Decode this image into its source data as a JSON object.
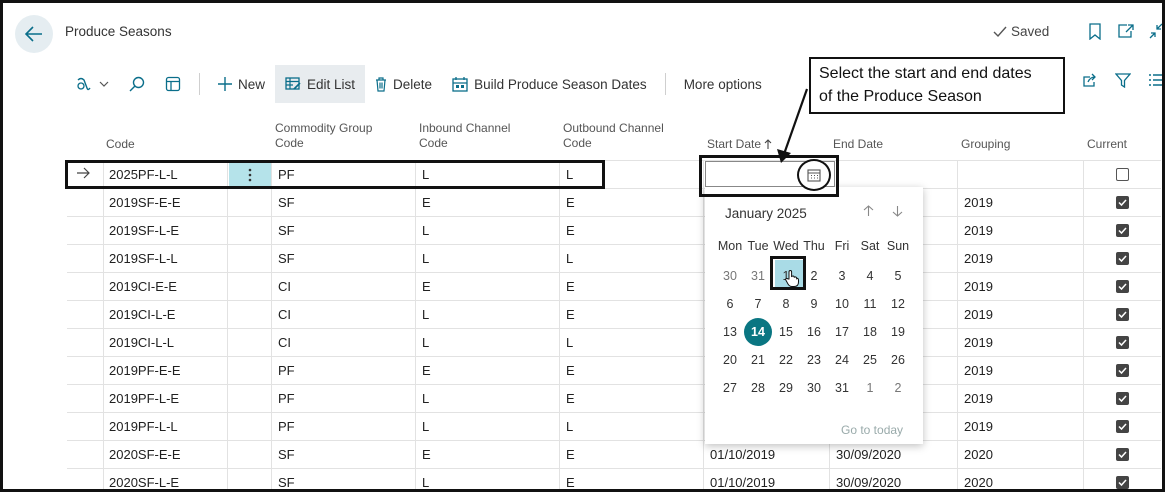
{
  "header": {
    "page_title": "Produce Seasons",
    "saved_label": "Saved"
  },
  "toolbar": {
    "new_label": "New",
    "edit_list_label": "Edit List",
    "delete_label": "Delete",
    "build_label": "Build Produce Season Dates",
    "more_label": "More options"
  },
  "callout": {
    "line1": "Select the start and end dates",
    "line2": "of the Produce Season"
  },
  "columns": {
    "code": "Code",
    "commodity_1": "Commodity Group",
    "commodity_2": "Code",
    "inbound_1": "Inbound Channel",
    "inbound_2": "Code",
    "outbound_1": "Outbound Channel",
    "outbound_2": "Code",
    "start_date": "Start Date",
    "start_sort_icon": "arrow-up",
    "end_date": "End Date",
    "grouping": "Grouping",
    "current": "Current"
  },
  "rows": [
    {
      "code": "2025PF-L-L",
      "commodity": "PF",
      "inbound": "L",
      "outbound": "L",
      "start": "",
      "end": "",
      "grouping": "",
      "current": false
    },
    {
      "code": "2019SF-E-E",
      "commodity": "SF",
      "inbound": "E",
      "outbound": "E",
      "start": "",
      "end": "",
      "grouping": "2019",
      "current": true
    },
    {
      "code": "2019SF-L-E",
      "commodity": "SF",
      "inbound": "L",
      "outbound": "E",
      "start": "",
      "end": "",
      "grouping": "2019",
      "current": true
    },
    {
      "code": "2019SF-L-L",
      "commodity": "SF",
      "inbound": "L",
      "outbound": "L",
      "start": "",
      "end": "",
      "grouping": "2019",
      "current": true
    },
    {
      "code": "2019CI-E-E",
      "commodity": "CI",
      "inbound": "E",
      "outbound": "E",
      "start": "",
      "end": "",
      "grouping": "2019",
      "current": true
    },
    {
      "code": "2019CI-L-E",
      "commodity": "CI",
      "inbound": "L",
      "outbound": "E",
      "start": "",
      "end": "",
      "grouping": "2019",
      "current": true
    },
    {
      "code": "2019CI-L-L",
      "commodity": "CI",
      "inbound": "L",
      "outbound": "L",
      "start": "",
      "end": "",
      "grouping": "2019",
      "current": true
    },
    {
      "code": "2019PF-E-E",
      "commodity": "PF",
      "inbound": "E",
      "outbound": "E",
      "start": "",
      "end": "",
      "grouping": "2019",
      "current": true
    },
    {
      "code": "2019PF-L-E",
      "commodity": "PF",
      "inbound": "L",
      "outbound": "E",
      "start": "",
      "end": "",
      "grouping": "2019",
      "current": true
    },
    {
      "code": "2019PF-L-L",
      "commodity": "PF",
      "inbound": "L",
      "outbound": "L",
      "start": "",
      "end": "",
      "grouping": "2019",
      "current": true
    },
    {
      "code": "2020SF-E-E",
      "commodity": "SF",
      "inbound": "E",
      "outbound": "E",
      "start": "01/10/2019",
      "end": "30/09/2020",
      "grouping": "2020",
      "current": true
    },
    {
      "code": "2020SF-L-E",
      "commodity": "SF",
      "inbound": "L",
      "outbound": "E",
      "start": "01/10/2019",
      "end": "30/09/2020",
      "grouping": "2020",
      "current": true
    }
  ],
  "datepicker": {
    "month_label": "January 2025",
    "weekdays": [
      "Mon",
      "Tue",
      "Wed",
      "Thu",
      "Fri",
      "Sat",
      "Sun"
    ],
    "weeks": [
      [
        "30",
        "31",
        "1",
        "2",
        "3",
        "4",
        "5"
      ],
      [
        "6",
        "7",
        "8",
        "9",
        "10",
        "11",
        "12"
      ],
      [
        "13",
        "14",
        "15",
        "16",
        "17",
        "18",
        "19"
      ],
      [
        "20",
        "21",
        "22",
        "23",
        "24",
        "25",
        "26"
      ],
      [
        "27",
        "28",
        "29",
        "30",
        "31",
        "1",
        "2"
      ]
    ],
    "today": "14",
    "hovered": "1",
    "go_today_label": "Go to today"
  },
  "colors": {
    "accent": "#0a7682",
    "hover": "#a9dbe6",
    "selected_cell": "#b5e3ea"
  }
}
